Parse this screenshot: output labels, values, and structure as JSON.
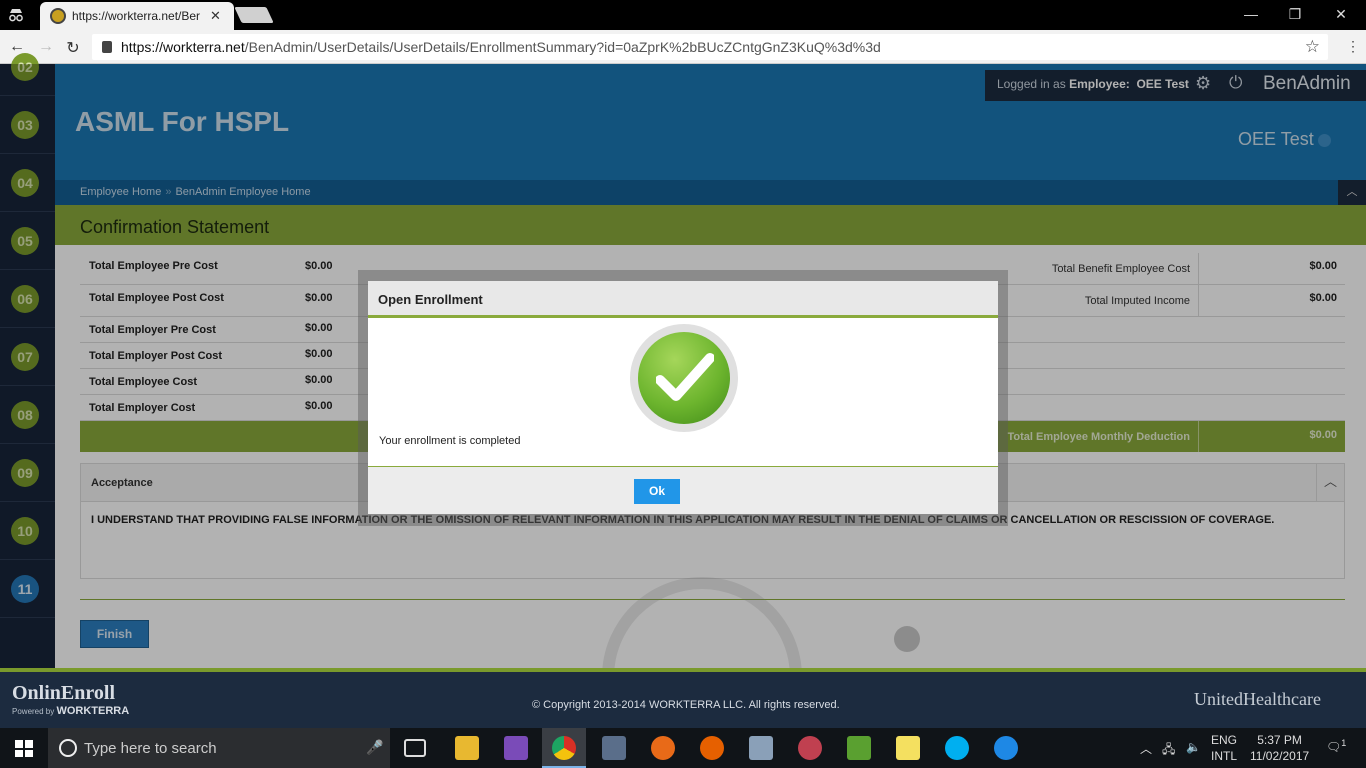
{
  "browser": {
    "tab_title": "https://workterra.net/Ber",
    "url_host": "https://workterra.net",
    "url_path": "/BenAdmin/UserDetails/UserDetails/EnrollmentSummary?id=0aZprK%2bBUcZCntgGnZ3KuQ%3d%3d"
  },
  "steps": [
    "02",
    "03",
    "04",
    "05",
    "06",
    "07",
    "08",
    "09",
    "10",
    "11"
  ],
  "active_step": "11",
  "header": {
    "logged_in_label": "Logged in as",
    "logged_in_role": "Employee:",
    "logged_in_user": "OEE Test",
    "brand": "BenAdmin",
    "app_title": "ASML For HSPL",
    "employee_name": "OEE Test"
  },
  "breadcrumb": [
    "Employee Home",
    "BenAdmin Employee Home"
  ],
  "page_title": "Confirmation Statement",
  "costs": [
    {
      "label": "Total Employee Pre Cost",
      "value": "$0.00",
      "right_label": "Total Benefit Employee Cost",
      "right_value": "$0.00"
    },
    {
      "label": "Total Employee Post Cost",
      "value": "$0.00",
      "right_label": "Total Imputed Income",
      "right_value": "$0.00"
    },
    {
      "label": "Total Employer Pre Cost",
      "value": "$0.00"
    },
    {
      "label": "Total Employer Post Cost",
      "value": "$0.00"
    },
    {
      "label": "Total Employee Cost",
      "value": "$0.00"
    },
    {
      "label": "Total Employer Cost",
      "value": "$0.00"
    }
  ],
  "total_row": {
    "label": "Total Employee Monthly Deduction",
    "value": "$0.00"
  },
  "acceptance": {
    "title": "Acceptance",
    "text": "I UNDERSTAND THAT PROVIDING FALSE INFORMATION OR THE OMISSION OF RELEVANT INFORMATION IN THIS APPLICATION MAY RESULT IN THE DENIAL OF CLAIMS OR CANCELLATION OR RESCISSION OF COVERAGE."
  },
  "finish_label": "Finish",
  "modal": {
    "title": "Open Enrollment",
    "message": "Your enrollment is completed",
    "ok_label": "Ok"
  },
  "footer": {
    "logo_main": "OnlinEnroll",
    "logo_powered": "Powered by",
    "logo_company": "WORKTERRA",
    "copyright": "© Copyright 2013-2014 WORKTERRA LLC. All rights reserved.",
    "partner": "UnitedHealthcare"
  },
  "taskbar": {
    "search_placeholder": "Type here to search",
    "lang_top": "ENG",
    "lang_bottom": "INTL",
    "time": "5:37 PM",
    "date": "11/02/2017",
    "notifications": "1"
  },
  "colors": {
    "header_blue": "#1a78b4",
    "accent_green": "#8aaa3c",
    "dark_navy": "#1c2b3f",
    "ok_blue": "#2196e8"
  }
}
